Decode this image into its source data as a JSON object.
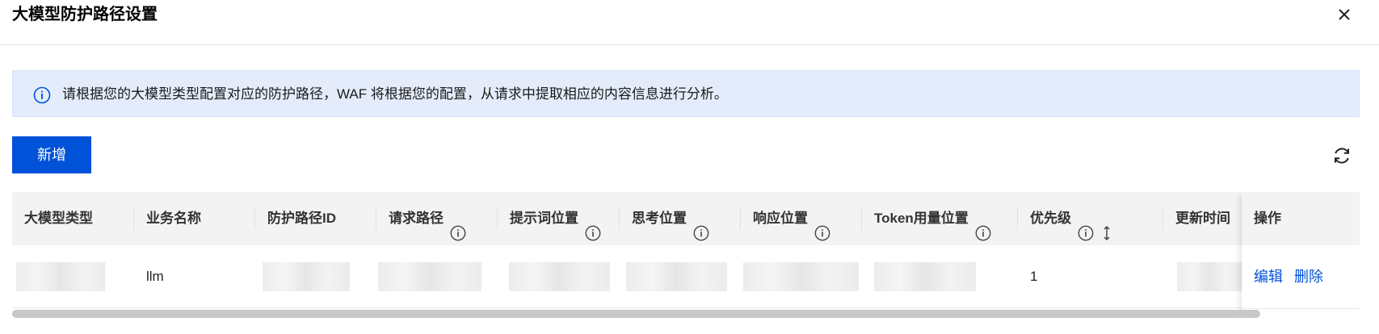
{
  "dialog": {
    "title": "大模型防护路径设置",
    "close_icon": "close-icon"
  },
  "notice": {
    "icon": "info-icon",
    "text": "请根据您的大模型类型配置对应的防护路径，WAF 将根据您的配置，从请求中提取相应的内容信息进行分析。"
  },
  "toolbar": {
    "add_label": "新增",
    "refresh_icon": "refresh-icon"
  },
  "table": {
    "columns": [
      {
        "label": "大模型类型",
        "info": false
      },
      {
        "label": "业务名称",
        "info": false
      },
      {
        "label": "防护路径ID",
        "info": false
      },
      {
        "label": "请求路径",
        "info": true
      },
      {
        "label": "提示词位置",
        "info": true
      },
      {
        "label": "思考位置",
        "info": true
      },
      {
        "label": "响应位置",
        "info": true
      },
      {
        "label": "Token用量位置",
        "info": true
      },
      {
        "label": "优先级",
        "info": true,
        "sortable": true
      },
      {
        "label": "更新时间",
        "info": false
      },
      {
        "label": "操作",
        "info": false
      }
    ],
    "rows": [
      {
        "model_type": "",
        "business_name": "llm",
        "path_id": "",
        "request_path": "",
        "prompt_position": "",
        "thinking_position": "",
        "response_position": "",
        "token_position": "",
        "priority": "1",
        "update_time": "",
        "actions": {
          "edit": "编辑",
          "delete": "删除"
        }
      }
    ]
  },
  "colors": {
    "primary": "#0052d9",
    "notice_bg": "#e4ecfb",
    "header_bg": "#f3f3f3"
  }
}
